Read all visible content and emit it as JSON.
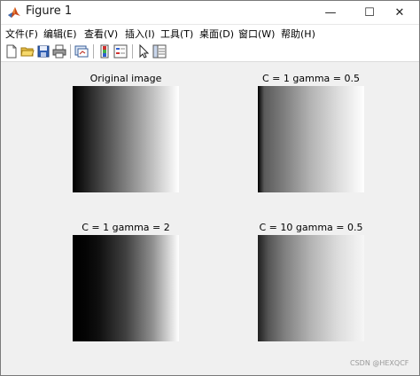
{
  "window": {
    "title": "Figure 1",
    "controls": {
      "minimize": "—",
      "maximize": "☐",
      "close": "✕"
    }
  },
  "menu": [
    "文件(F)",
    "编辑(E)",
    "查看(V)",
    "插入(I)",
    "工具(T)",
    "桌面(D)",
    "窗口(W)",
    "帮助(H)"
  ],
  "toolbar": {
    "icons": [
      "new-figure-icon",
      "open-file-icon",
      "save-icon",
      "print-icon",
      "link-plot-icon",
      "colorbar-icon",
      "legend-icon",
      "pointer-icon",
      "property-inspector-icon"
    ]
  },
  "subplots": [
    {
      "title": "Original image",
      "gradient": "linear"
    },
    {
      "title": "C = 1 gamma = 0.5",
      "gradient": "gamma-0.5"
    },
    {
      "title": "C = 1 gamma = 2",
      "gradient": "gamma-2"
    },
    {
      "title": "C = 10 gamma = 0.5",
      "gradient": "gamma-0.5-c10"
    }
  ],
  "watermark": "CSDN @HEXQCF"
}
